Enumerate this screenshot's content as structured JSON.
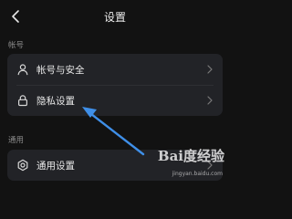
{
  "header": {
    "title": "设置",
    "back_icon": "chevron-left-icon"
  },
  "sections": [
    {
      "label": "帐号",
      "items": [
        {
          "icon": "user-icon",
          "label": "帐号与安全"
        },
        {
          "icon": "lock-icon",
          "label": "隐私设置"
        }
      ]
    },
    {
      "label": "通用",
      "items": [
        {
          "icon": "gear-icon",
          "label": "通用设置"
        }
      ]
    }
  ],
  "annotation": {
    "arrow_color": "#3f8fe8",
    "target": "隐私设置"
  },
  "watermark": {
    "logo": "Bai度经验",
    "url": "jingyan.baidu.com"
  },
  "colors": {
    "background": "#121212",
    "card": "#222327",
    "text": "#e8e8e8",
    "section_label": "#8a8a8a",
    "arrow": "#3f8fe8"
  }
}
